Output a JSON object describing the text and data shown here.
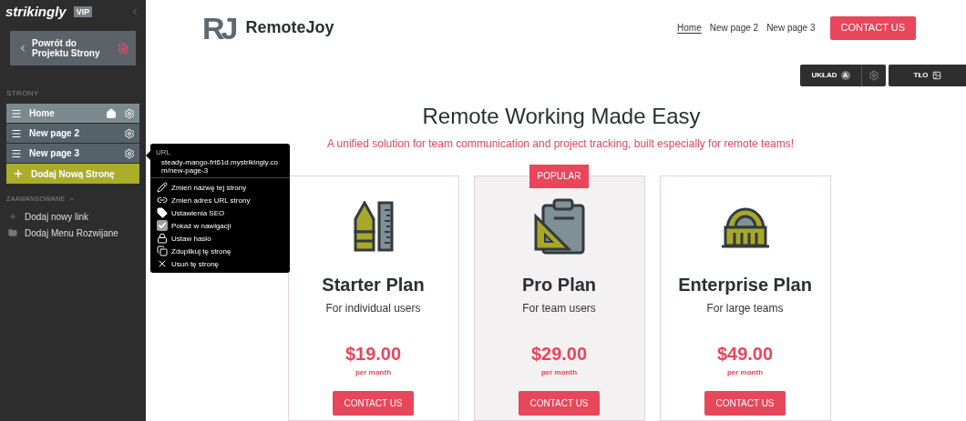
{
  "sidebar": {
    "brand": "strikingly",
    "brand_badge": "VIP",
    "back_button": "Powrót do Projektu Strony",
    "section_title": "STRONY",
    "pages": [
      {
        "label": "Home",
        "home": true,
        "selected": true
      },
      {
        "label": "New page 2",
        "home": false,
        "selected": false
      },
      {
        "label": "New page 3",
        "home": false,
        "selected": false
      }
    ],
    "add_page": "Dodaj Nową Stronę",
    "advanced_title": "ZAAWANSOWANE",
    "advanced_items": [
      {
        "label": "Dodaj nowy link",
        "kind": "link"
      },
      {
        "label": "Dodaj Menu Rozwijane",
        "kind": "folder"
      }
    ]
  },
  "page_menu": {
    "url_label": "URL",
    "url": "steady-mango-frt61d.mystrikingly.com/new-page-3",
    "items": [
      {
        "label": "Zmień nazwę tej strony",
        "kind": "rename"
      },
      {
        "label": "Zmień adres URL strony",
        "kind": "link"
      },
      {
        "label": "Ustawienia SEO",
        "kind": "tag"
      },
      {
        "label": "Pokaż w nawigacji",
        "kind": "checkbox",
        "checked": true
      },
      {
        "label": "Ustaw hasło",
        "kind": "lock"
      },
      {
        "label": "Zduplikuj tę stronę",
        "kind": "copy"
      },
      {
        "label": "Usuń tę stronę",
        "kind": "delete"
      }
    ]
  },
  "site": {
    "logo_mark": "RJ",
    "name": "RemoteJoy",
    "nav": [
      {
        "label": "Home",
        "selected": true
      },
      {
        "label": "New page 2",
        "selected": false
      },
      {
        "label": "New page 3",
        "selected": false
      }
    ],
    "nav_button": "CONTACT US",
    "editor_buttons": {
      "layout": "UKŁAD",
      "layout_badge": "A",
      "background": "TŁO"
    },
    "title": "Remote Working Made Easy",
    "subtitle": "A unified solution for team communication and project tracking, built especially for remote teams!",
    "plans": [
      {
        "name": "Starter Plan",
        "audience": "For individual users",
        "price": "$19.00",
        "period": "per month",
        "button": "CONTACT US",
        "kind": "pen",
        "highlighted": false
      },
      {
        "name": "Pro Plan",
        "audience": "For team users",
        "price": "$29.00",
        "period": "per month",
        "button": "CONTACT US",
        "kind": "clipboard",
        "highlighted": true,
        "badge": "POPULAR"
      },
      {
        "name": "Enterprise Plan",
        "audience": "For large teams",
        "price": "$49.00",
        "period": "per month",
        "button": "CONTACT US",
        "kind": "building",
        "highlighted": false
      }
    ]
  }
}
